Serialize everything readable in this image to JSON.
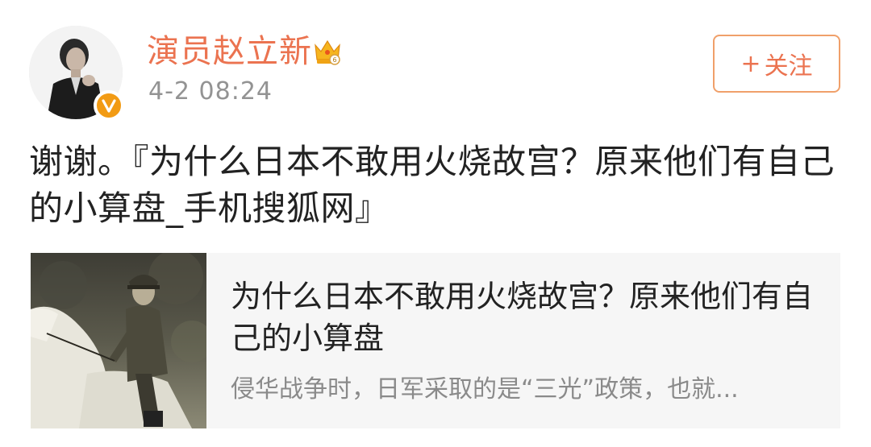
{
  "header": {
    "username": "演员赵立新",
    "timestamp": "4-2 08:24",
    "follow_plus": "+",
    "follow_label": "关注",
    "avatar_icon": "avatar-photo",
    "verified_icon": "verified-v-icon",
    "vip_icon": "crown-icon"
  },
  "post": {
    "text": "谢谢。『为什么日本不敢用火烧故宫？原来他们有自己的小算盘_手机搜狐网』"
  },
  "card": {
    "title": "为什么日本不敢用火烧故宫？原来他们有自己的小算盘",
    "description": "侵华战争时，日军采取的是“三光”政策，也就...",
    "thumbnail_icon": "sepia-photo-officer-on-white-horse"
  },
  "colors": {
    "accent": "#eb7350",
    "verified": "#f29b14",
    "timestamp": "#939393",
    "card_bg": "#f6f6f6"
  }
}
